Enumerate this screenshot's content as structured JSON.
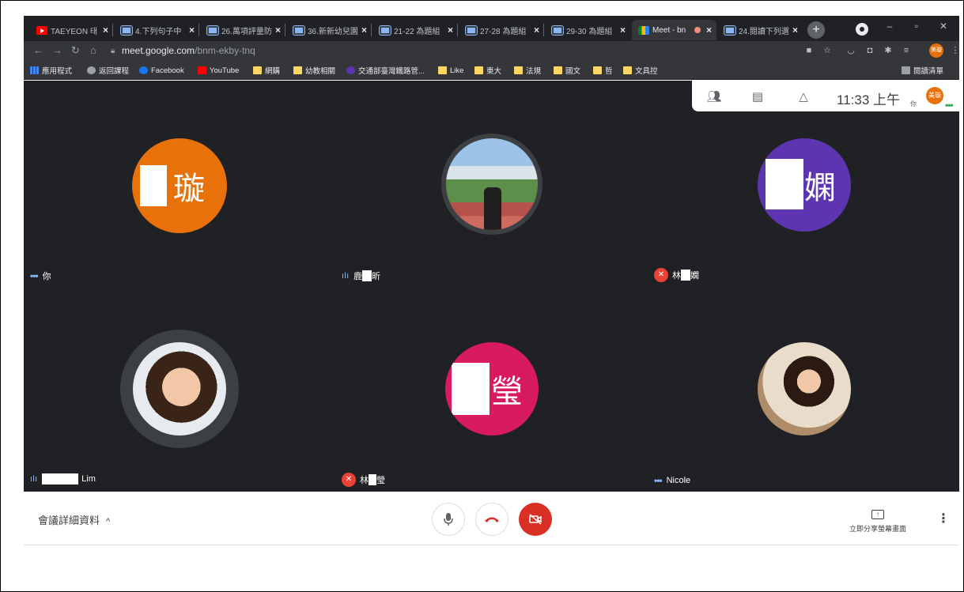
{
  "browser": {
    "tabs": [
      {
        "title": "TAEYEON 태",
        "icon": "youtube-icon"
      },
      {
        "title": "4.下列句子中",
        "icon": "document-icon"
      },
      {
        "title": "26.萬項評量防",
        "icon": "document-icon"
      },
      {
        "title": "36.新新幼兒園",
        "icon": "document-icon"
      },
      {
        "title": "21-22 為題組",
        "icon": "document-icon"
      },
      {
        "title": "27-28 為題組",
        "icon": "document-icon"
      },
      {
        "title": "29-30 為題組",
        "icon": "document-icon"
      },
      {
        "title": "Meet - bn",
        "icon": "meet-icon"
      },
      {
        "title": "24.閱讀下列選",
        "icon": "document-icon"
      }
    ],
    "new_tab": "+",
    "url": "meet.google.com",
    "url_path": "/bnm-ekby-tnq",
    "profile_initials": "美璇",
    "bookmarks": [
      {
        "label": "應用程式",
        "icon": "apps"
      },
      {
        "label": "返回課程",
        "icon": "globe"
      },
      {
        "label": "Facebook",
        "icon": "fb"
      },
      {
        "label": "YouTube",
        "icon": "yt"
      },
      {
        "label": "網購",
        "icon": "folder"
      },
      {
        "label": "幼教相關",
        "icon": "folder"
      },
      {
        "label": "交通部臺灣鐵路管...",
        "icon": "gov"
      },
      {
        "label": "Like",
        "icon": "folder"
      },
      {
        "label": "東大",
        "icon": "folder"
      },
      {
        "label": "法規",
        "icon": "folder"
      },
      {
        "label": "國文",
        "icon": "folder"
      },
      {
        "label": "哲",
        "icon": "folder"
      },
      {
        "label": "文具控",
        "icon": "folder"
      }
    ],
    "reading_list": "閱讀清單"
  },
  "meet": {
    "self_panel": {
      "time": "11:33 上午",
      "you_label": "你",
      "avatar_initials": "美璇"
    },
    "participants": [
      {
        "name": "你",
        "initial": "璇",
        "color": "#e8710a",
        "status": "dots"
      },
      {
        "name_left": "鹿",
        "name_right": "昕",
        "status": "speaking"
      },
      {
        "name_left": "林",
        "name_right": "嫻",
        "initial": "嫻",
        "color": "#5e35b1",
        "status": "muted"
      },
      {
        "name": "Lim",
        "status": "speaking"
      },
      {
        "name_left": "林",
        "name_right": "瑩",
        "initial": "瑩",
        "color": "#d81b60",
        "status": "muted"
      },
      {
        "name": "Nicole",
        "status": "dots"
      }
    ],
    "controls": {
      "meeting_details": "會議詳細資料",
      "present_now": "立即分享螢幕畫面"
    }
  }
}
